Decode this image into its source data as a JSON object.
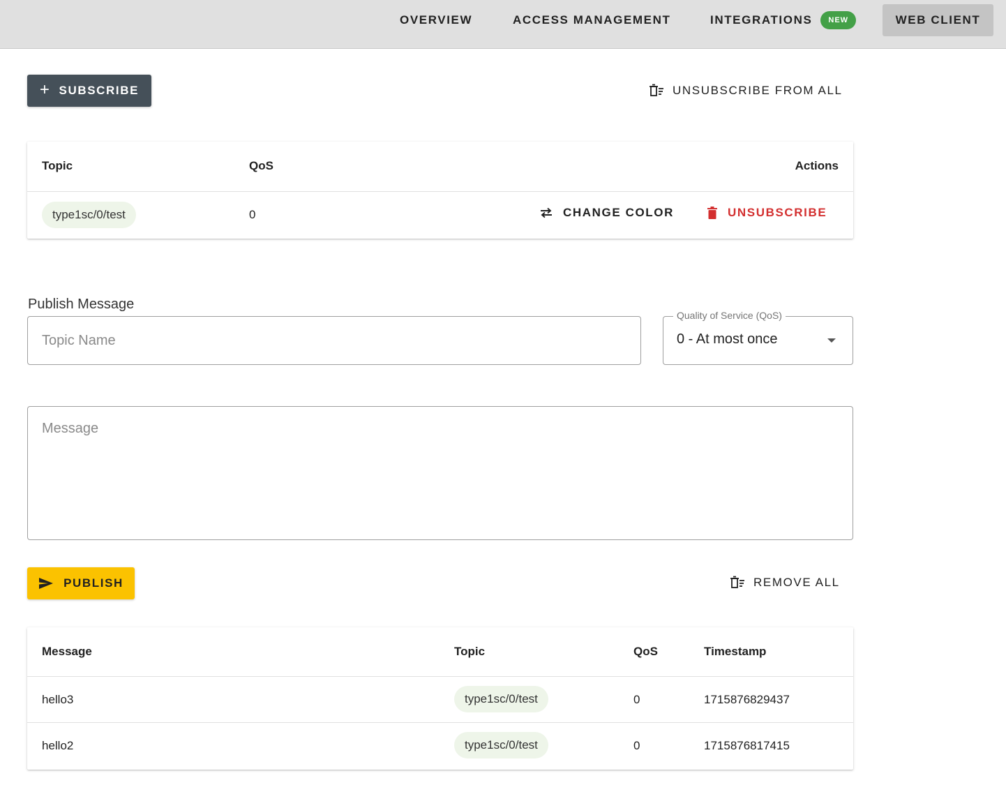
{
  "nav": {
    "items": [
      {
        "label": "OVERVIEW"
      },
      {
        "label": "ACCESS MANAGEMENT"
      },
      {
        "label": "INTEGRATIONS",
        "badge": "NEW"
      },
      {
        "label": "WEB CLIENT",
        "active": true
      }
    ],
    "badge_color": "#43a047"
  },
  "subscriptions": {
    "subscribe_label": "SUBSCRIBE",
    "unsubscribe_all_label": "UNSUBSCRIBE FROM ALL",
    "headers": {
      "topic": "Topic",
      "qos": "QoS",
      "actions": "Actions"
    },
    "rows": [
      {
        "topic": "type1sc/0/test",
        "qos": "0",
        "change_color": "CHANGE COLOR",
        "unsubscribe": "UNSUBSCRIBE"
      }
    ]
  },
  "publish": {
    "section_label": "Publish Message",
    "topic_placeholder": "Topic Name",
    "qos_label": "Quality of Service (QoS)",
    "qos_value": "0 - At most once",
    "message_placeholder": "Message",
    "publish_label": "PUBLISH",
    "remove_all_label": "REMOVE ALL"
  },
  "messages": {
    "headers": {
      "message": "Message",
      "topic": "Topic",
      "qos": "QoS",
      "timestamp": "Timestamp"
    },
    "rows": [
      {
        "message": "hello3",
        "topic": "type1sc/0/test",
        "qos": "0",
        "timestamp": "1715876829437"
      },
      {
        "message": "hello2",
        "topic": "type1sc/0/test",
        "qos": "0",
        "timestamp": "1715876817415"
      }
    ]
  },
  "colors": {
    "subscribe_button": "#455059",
    "publish_button": "#fbc200",
    "danger": "#d32f2f",
    "chip": "#eef5e9"
  }
}
